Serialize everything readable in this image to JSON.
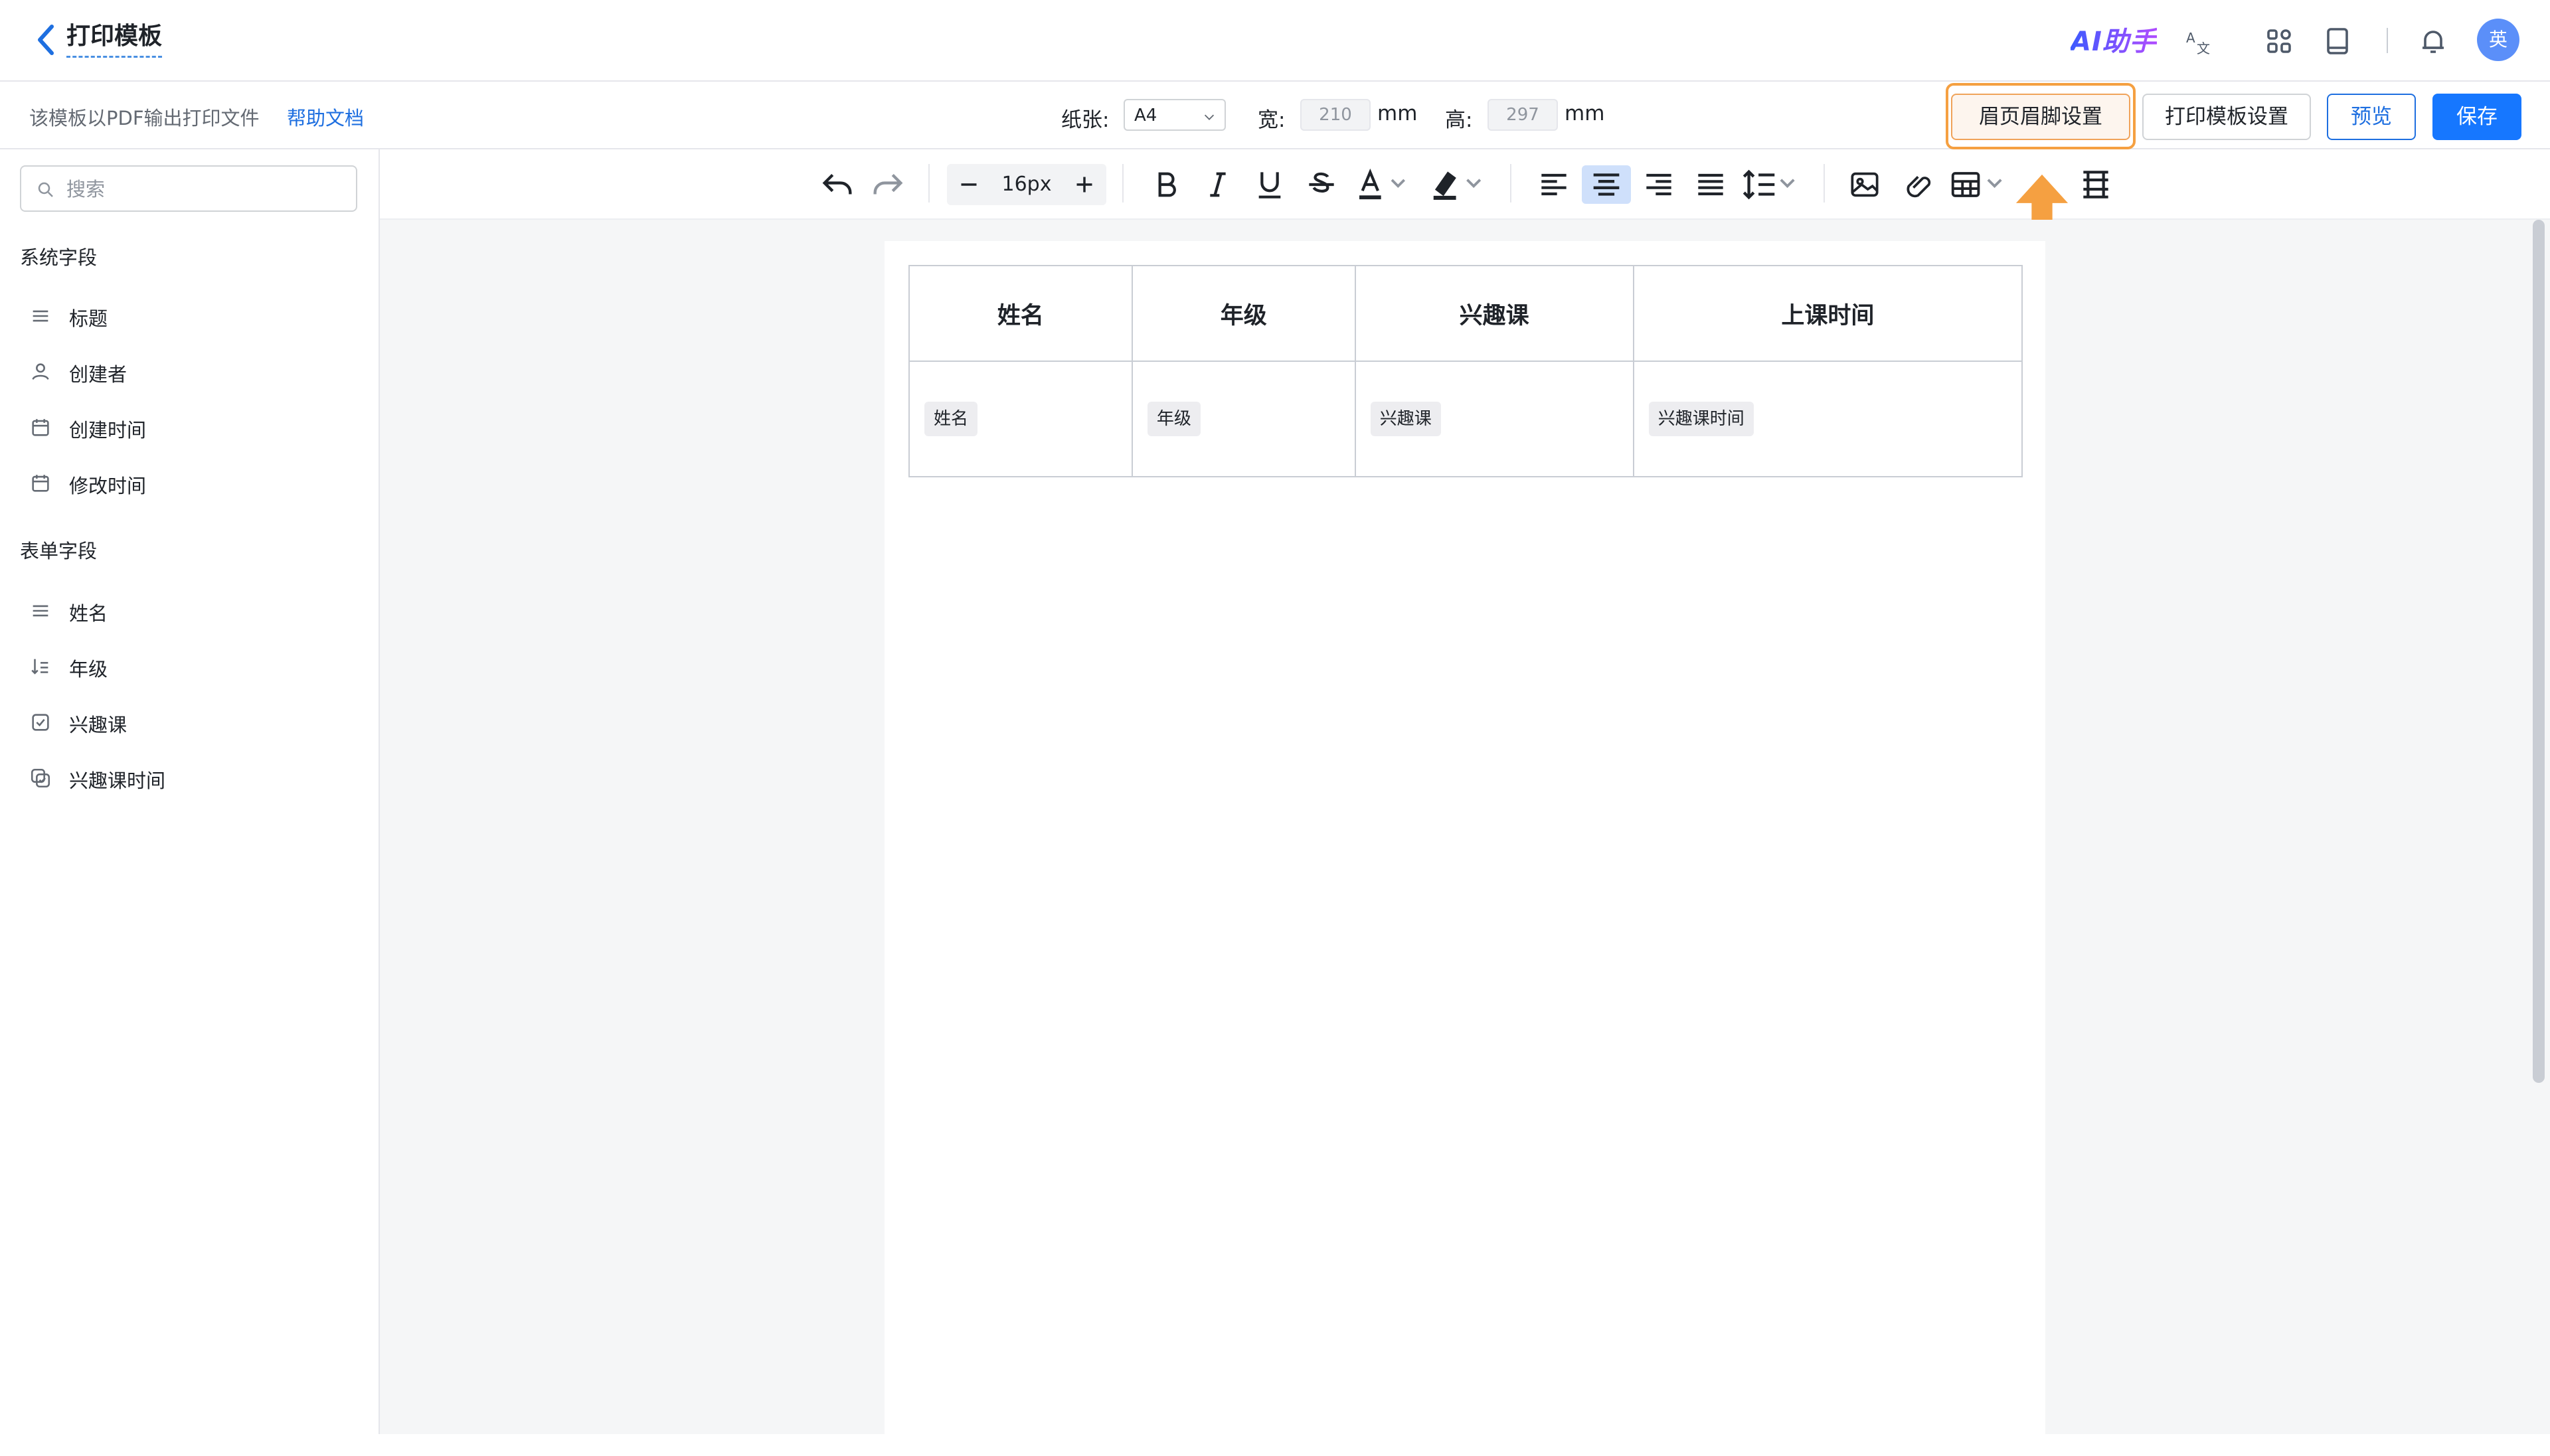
{
  "header": {
    "title": "打印模板",
    "ai_label": "AI助手",
    "avatar_text": "英"
  },
  "subbar": {
    "description": "该模板以PDF输出打印文件",
    "help_link": "帮助文档",
    "paper_label": "纸张:",
    "paper_value": "A4",
    "width_label": "宽:",
    "width_value": "210",
    "width_unit": "mm",
    "height_label": "高:",
    "height_value": "297",
    "height_unit": "mm",
    "header_footer_btn": "眉页眉脚设置",
    "template_settings_btn": "打印模板设置",
    "preview_btn": "预览",
    "save_btn": "保存"
  },
  "sidebar": {
    "search_placeholder": "搜索",
    "system_group": "系统字段",
    "system_fields": [
      {
        "label": "标题",
        "icon": "text-lines-icon"
      },
      {
        "label": "创建者",
        "icon": "user-icon"
      },
      {
        "label": "创建时间",
        "icon": "calendar-icon"
      },
      {
        "label": "修改时间",
        "icon": "calendar-icon"
      }
    ],
    "form_group": "表单字段",
    "form_fields": [
      {
        "label": "姓名",
        "icon": "text-lines-icon"
      },
      {
        "label": "年级",
        "icon": "sort-icon"
      },
      {
        "label": "兴趣课",
        "icon": "checkbox-icon"
      },
      {
        "label": "兴趣课时间",
        "icon": "multi-select-icon"
      }
    ]
  },
  "toolbar": {
    "font_size": "16px"
  },
  "table": {
    "headers": [
      "姓名",
      "年级",
      "兴趣课",
      "上课时间"
    ],
    "cells": [
      "姓名",
      "年级",
      "兴趣课",
      "兴趣课时间"
    ]
  },
  "colors": {
    "primary": "#1677ff",
    "highlight_ring": "#f5a041",
    "arrow": "#f5a041"
  }
}
